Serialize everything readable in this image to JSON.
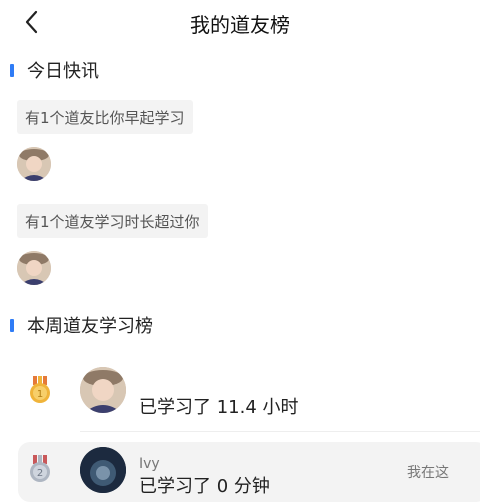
{
  "header": {
    "title": "我的道友榜"
  },
  "today": {
    "section_title": "今日快讯",
    "items": [
      {
        "text": "有1个道友比你早起学习"
      },
      {
        "text": "有1个道友学习时长超过你"
      }
    ]
  },
  "weekly": {
    "section_title": "本周道友学习榜",
    "rows": [
      {
        "rank": "1",
        "name": "",
        "value_text": "已学习了 11.4 小时",
        "medal_color": "#f0b43a"
      },
      {
        "rank": "2",
        "name": "Ivy",
        "value_text": "已学习了 0 分钟",
        "tag": "我在这",
        "medal_color": "#aeb6c2"
      }
    ]
  }
}
